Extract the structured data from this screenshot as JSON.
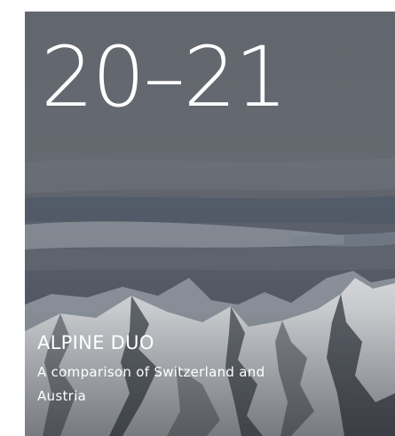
{
  "hero": {
    "year_range": "20–21",
    "title": "ALPINE DUO",
    "subtitle": "A comparison of Switzerland and Austria"
  },
  "colors": {
    "text": "#ffffff",
    "overlay": "#5e636c",
    "cloud_band": "#8f9aa6",
    "snow": "#e6e9ee",
    "rock": "#3b3f47"
  }
}
